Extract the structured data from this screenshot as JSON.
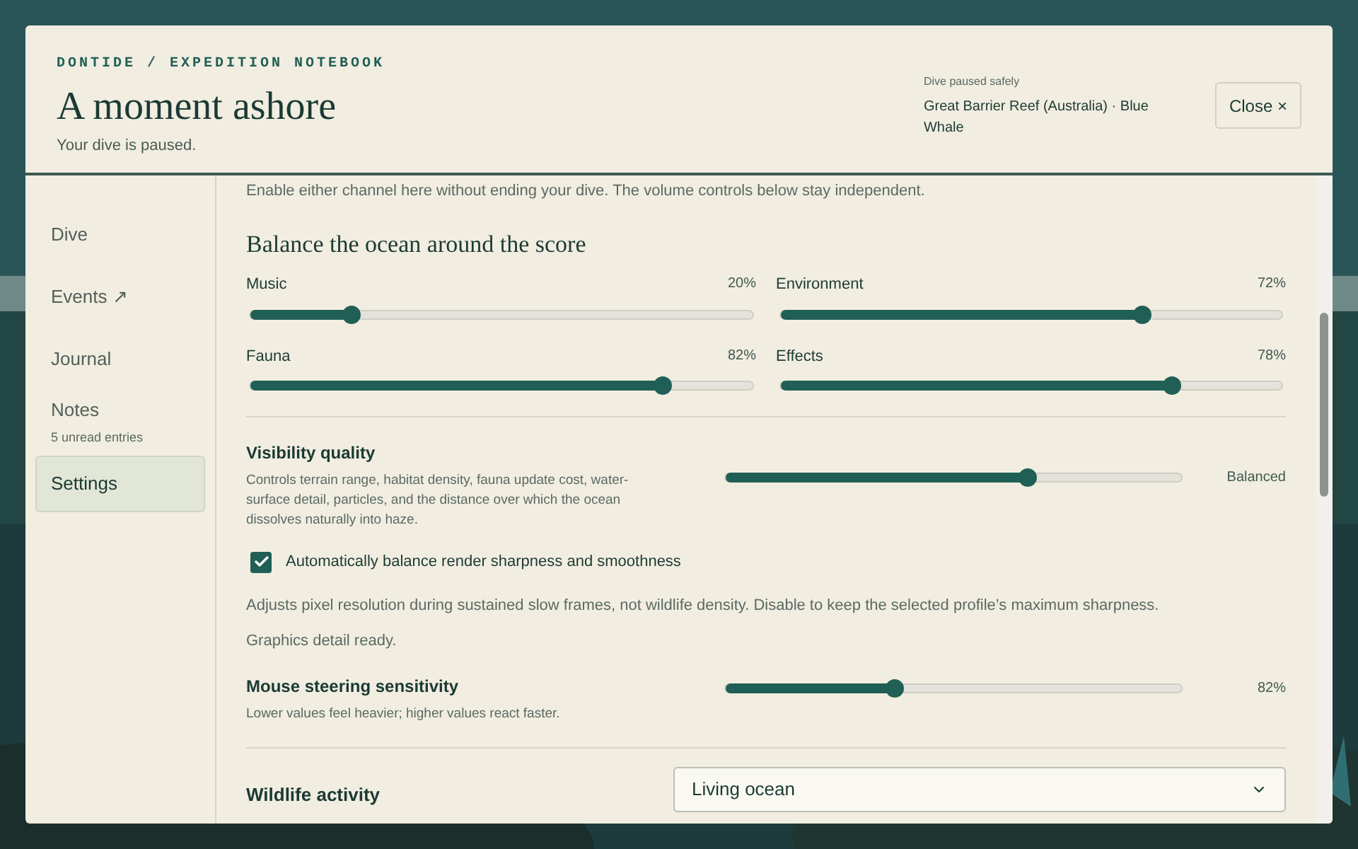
{
  "header": {
    "eyebrow": "DONTIDE / EXPEDITION NOTEBOOK",
    "title": "A moment ashore",
    "subtitle": "Your dive is paused.",
    "status_label": "Dive paused safely",
    "status_location": "Great Barrier Reef (Australia) · Blue Whale",
    "close_button": "Close ×"
  },
  "sidebar": {
    "items": [
      {
        "label": "Dive",
        "selected": false
      },
      {
        "label": "Events ↗",
        "selected": false
      },
      {
        "label": "Journal",
        "selected": false
      },
      {
        "label": "Notes",
        "sublabel": "5 unread entries",
        "selected": false
      },
      {
        "label": "Settings",
        "selected": true
      }
    ]
  },
  "content": {
    "intro": "Enable either channel here without ending your dive. The volume controls below stay independent.",
    "mix_heading": "Balance the ocean around the score",
    "mix_sliders": [
      {
        "label": "Music",
        "reading": "20%",
        "level": 0.2
      },
      {
        "label": "Environment",
        "reading": "72%",
        "level": 0.72
      },
      {
        "label": "Fauna",
        "reading": "82%",
        "level": 0.82
      },
      {
        "label": "Effects",
        "reading": "78%",
        "level": 0.78
      }
    ],
    "visibility": {
      "title": "Visibility quality",
      "description": "Controls terrain range, habitat density, fauna update cost, water-surface detail, particles, and the distance over which the ocean dissolves naturally into haze.",
      "level": 0.66,
      "reading": "Balanced"
    },
    "auto_balance": {
      "label": "Automatically balance render sharpness and smoothness",
      "checked": true
    },
    "auto_note": "Adjusts pixel resolution during sustained slow frames, not wildlife density. Disable to keep the selected profile’s maximum sharpness.",
    "graphics_status": "Graphics detail ready.",
    "mouse": {
      "title": "Mouse steering sensitivity",
      "description": "Lower values feel heavier; higher values react faster.",
      "level": 0.37,
      "reading": "82%"
    },
    "wildlife": {
      "title": "Wildlife activity",
      "value": "Living ocean"
    }
  }
}
